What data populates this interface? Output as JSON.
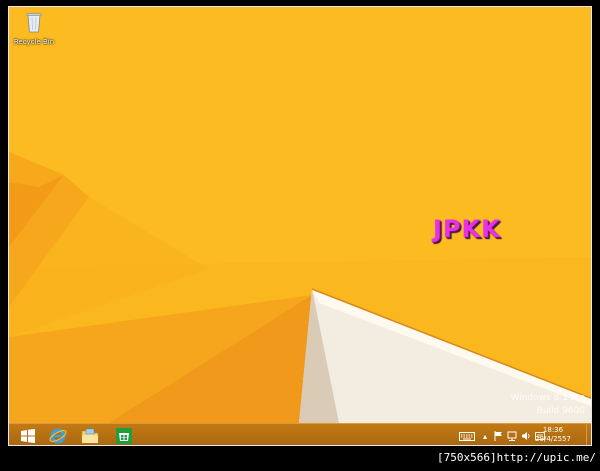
{
  "desktop": {
    "icons": [
      {
        "label": "Recycle Bin",
        "icon": "recycle-bin-icon"
      }
    ],
    "watermark": "JPKK",
    "edition": "Windows 8.1 Pro",
    "build": "Build 9600",
    "colors": {
      "wallpaper": "#fbb81e",
      "watermark": "#e830e8"
    }
  },
  "taskbar": {
    "pinned": [
      {
        "name": "start",
        "icon": "windows-logo-icon"
      },
      {
        "name": "internet-explorer",
        "icon": "internet-explorer-icon"
      },
      {
        "name": "file-explorer",
        "icon": "folder-icon"
      },
      {
        "name": "store",
        "icon": "store-icon"
      }
    ],
    "tray": {
      "icons": [
        "keyboard-icon",
        "chevron-up-icon",
        "flag-icon",
        "network-icon",
        "volume-icon",
        "language-icon"
      ],
      "time": "18:36",
      "date": "29/4/2557"
    }
  },
  "caption": "[750x566]http://upic.me/"
}
